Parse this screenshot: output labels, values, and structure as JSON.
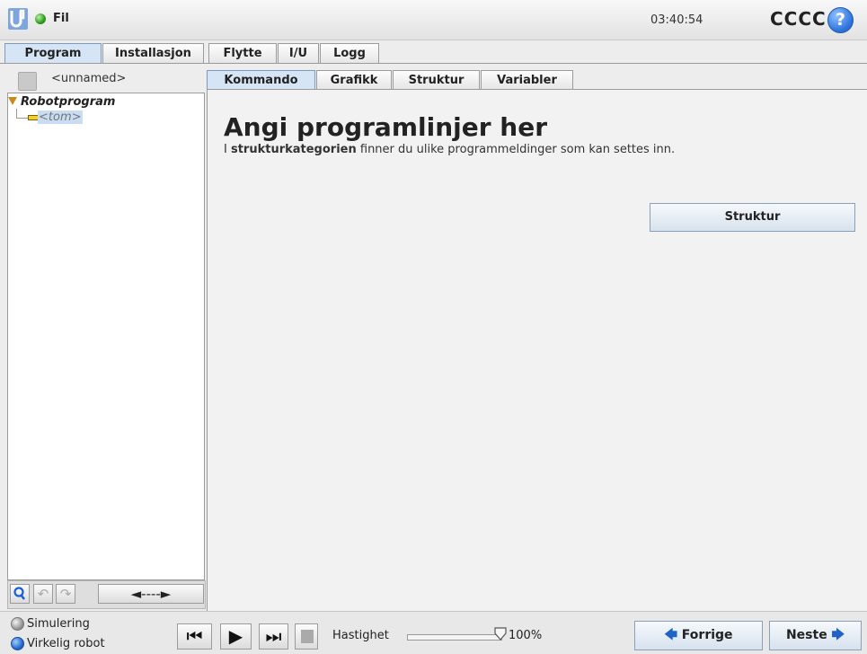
{
  "topbar": {
    "file_menu": "Fil",
    "clock": "03:40:54",
    "robot_name": "CCCC",
    "help_glyph": "?",
    "status_color": "#2c9a1a"
  },
  "main_tabs": [
    {
      "label": "Program",
      "active": true
    },
    {
      "label": "Installasjon",
      "active": false
    },
    {
      "label": "Flytte",
      "active": false
    },
    {
      "label": "I/U",
      "active": false
    },
    {
      "label": "Logg",
      "active": false
    }
  ],
  "left": {
    "program_name": "<unnamed>",
    "tree_root": "Robotprogram",
    "tree_child": "<tom>",
    "toolbar": {
      "search_icon": "search-icon",
      "move_glyph": "◄----►"
    }
  },
  "sub_tabs": [
    {
      "label": "Kommando",
      "active": true
    },
    {
      "label": "Grafikk",
      "active": false
    },
    {
      "label": "Struktur",
      "active": false
    },
    {
      "label": "Variabler",
      "active": false
    }
  ],
  "content": {
    "heading": "Angi programlinjer her",
    "sub_prefix": "I ",
    "sub_bold": "strukturkategorien",
    "sub_suffix": " finner du ulike programmeldinger som kan settes inn.",
    "structure_button": "Struktur"
  },
  "bottom": {
    "simulation_label": "Simulering",
    "real_robot_label": "Virkelig robot",
    "speed_label": "Hastighet",
    "speed_value": "100%",
    "speed_fraction": 1.0,
    "prev_label": "Forrige",
    "next_label": "Neste"
  },
  "colors": {
    "accent": "#1f63c9",
    "tab_active": "#d6e5f5"
  }
}
